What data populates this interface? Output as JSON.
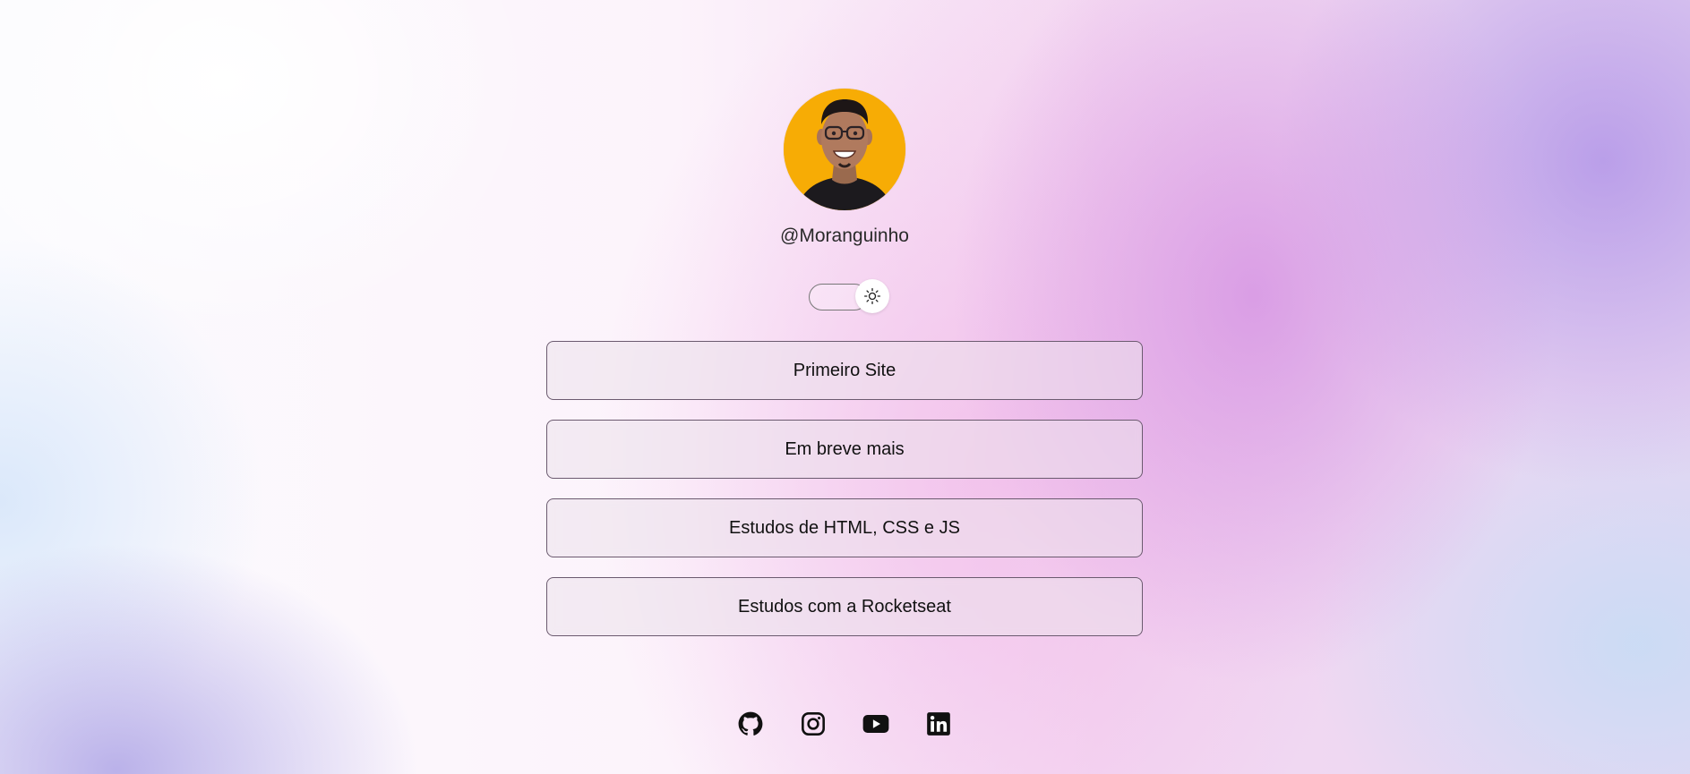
{
  "profile": {
    "username": "@Moranguinho",
    "avatar_alt": "profile-photo",
    "avatar_bg_color": "#f7ac05"
  },
  "theme_toggle": {
    "icon": "sun-icon",
    "state": "light"
  },
  "links": [
    {
      "label": "Primeiro Site"
    },
    {
      "label": "Em breve mais"
    },
    {
      "label": "Estudos de HTML, CSS e JS"
    },
    {
      "label": "Estudos com a Rocketseat"
    }
  ],
  "social": [
    {
      "icon": "github-icon"
    },
    {
      "icon": "instagram-icon"
    },
    {
      "icon": "youtube-icon"
    },
    {
      "icon": "linkedin-icon"
    }
  ]
}
